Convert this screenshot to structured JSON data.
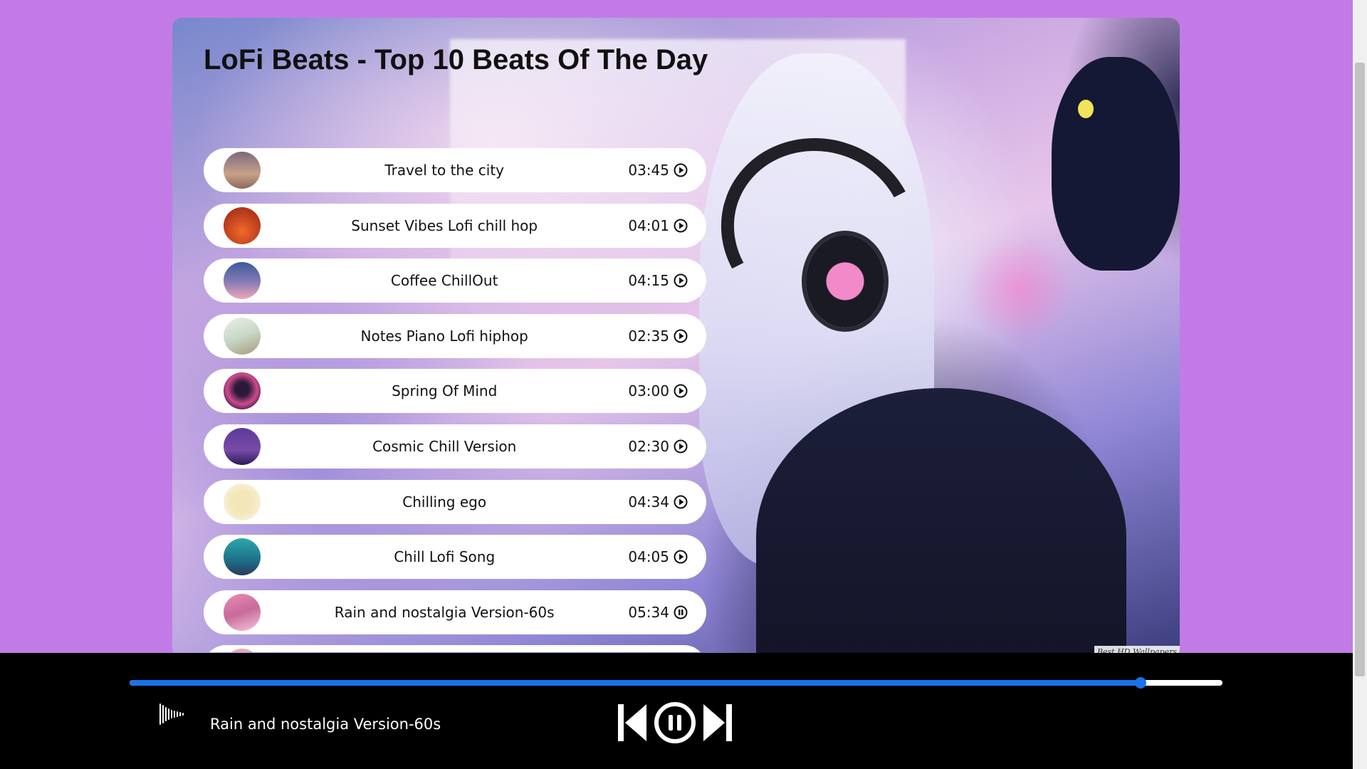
{
  "page": {
    "title": "LoFi Beats - Top 10 Beats Of The Day",
    "watermark": "Best HD Wallpapers"
  },
  "colors": {
    "page_background": "#c27be6",
    "accent": "#1a73e8",
    "player_bar": "#000000"
  },
  "tracks": [
    {
      "name": "Travel to the city",
      "duration": "03:45",
      "state": "play",
      "thumb": "linear-gradient(180deg,#7a6a7a,#c9a08a 60%,#8a6a5a)"
    },
    {
      "name": "Sunset Vibes Lofi chill hop",
      "duration": "04:01",
      "state": "play",
      "thumb": "radial-gradient(circle at 50% 65%,#f06a2a,#b2361a 70%)"
    },
    {
      "name": "Coffee ChillOut",
      "duration": "04:15",
      "state": "play",
      "thumb": "linear-gradient(180deg,#3e5a9a,#8a7cb8 55%,#f0a7b5)"
    },
    {
      "name": "Notes Piano Lofi hiphop",
      "duration": "02:35",
      "state": "play",
      "thumb": "linear-gradient(160deg,#e8efe8,#c8d8c8 50%,#a89a7a)"
    },
    {
      "name": "Spring Of Mind",
      "duration": "03:00",
      "state": "play",
      "thumb": "radial-gradient(circle at 50% 45%,#2a1a3a 25%,#d04a8a 55%,#3a1a5a 80%)"
    },
    {
      "name": "Cosmic Chill Version",
      "duration": "02:30",
      "state": "play",
      "thumb": "linear-gradient(180deg,#5a3a9a,#7a4aa8 60%,#2a1a5a)"
    },
    {
      "name": "Chilling ego",
      "duration": "04:34",
      "state": "play",
      "thumb": "radial-gradient(circle,#f3e6b8 40%,#f7efd2 70%)"
    },
    {
      "name": "Chill Lofi Song",
      "duration": "04:05",
      "state": "play",
      "thumb": "linear-gradient(180deg,#2aa8a8,#1e6f8a 60%,#2a3a5a)"
    },
    {
      "name": "Rain and nostalgia Version-60s",
      "duration": "05:34",
      "state": "pause",
      "thumb": "linear-gradient(160deg,#e98db8,#c86a9a 50%,#f5c8dc)"
    },
    {
      "name": "",
      "duration": "",
      "state": "play",
      "thumb": "linear-gradient(180deg,#e8a8c8,#c88ab8)"
    }
  ],
  "player": {
    "now_playing": "Rain and nostalgia Version-60s",
    "progress_percent": 92.5
  }
}
